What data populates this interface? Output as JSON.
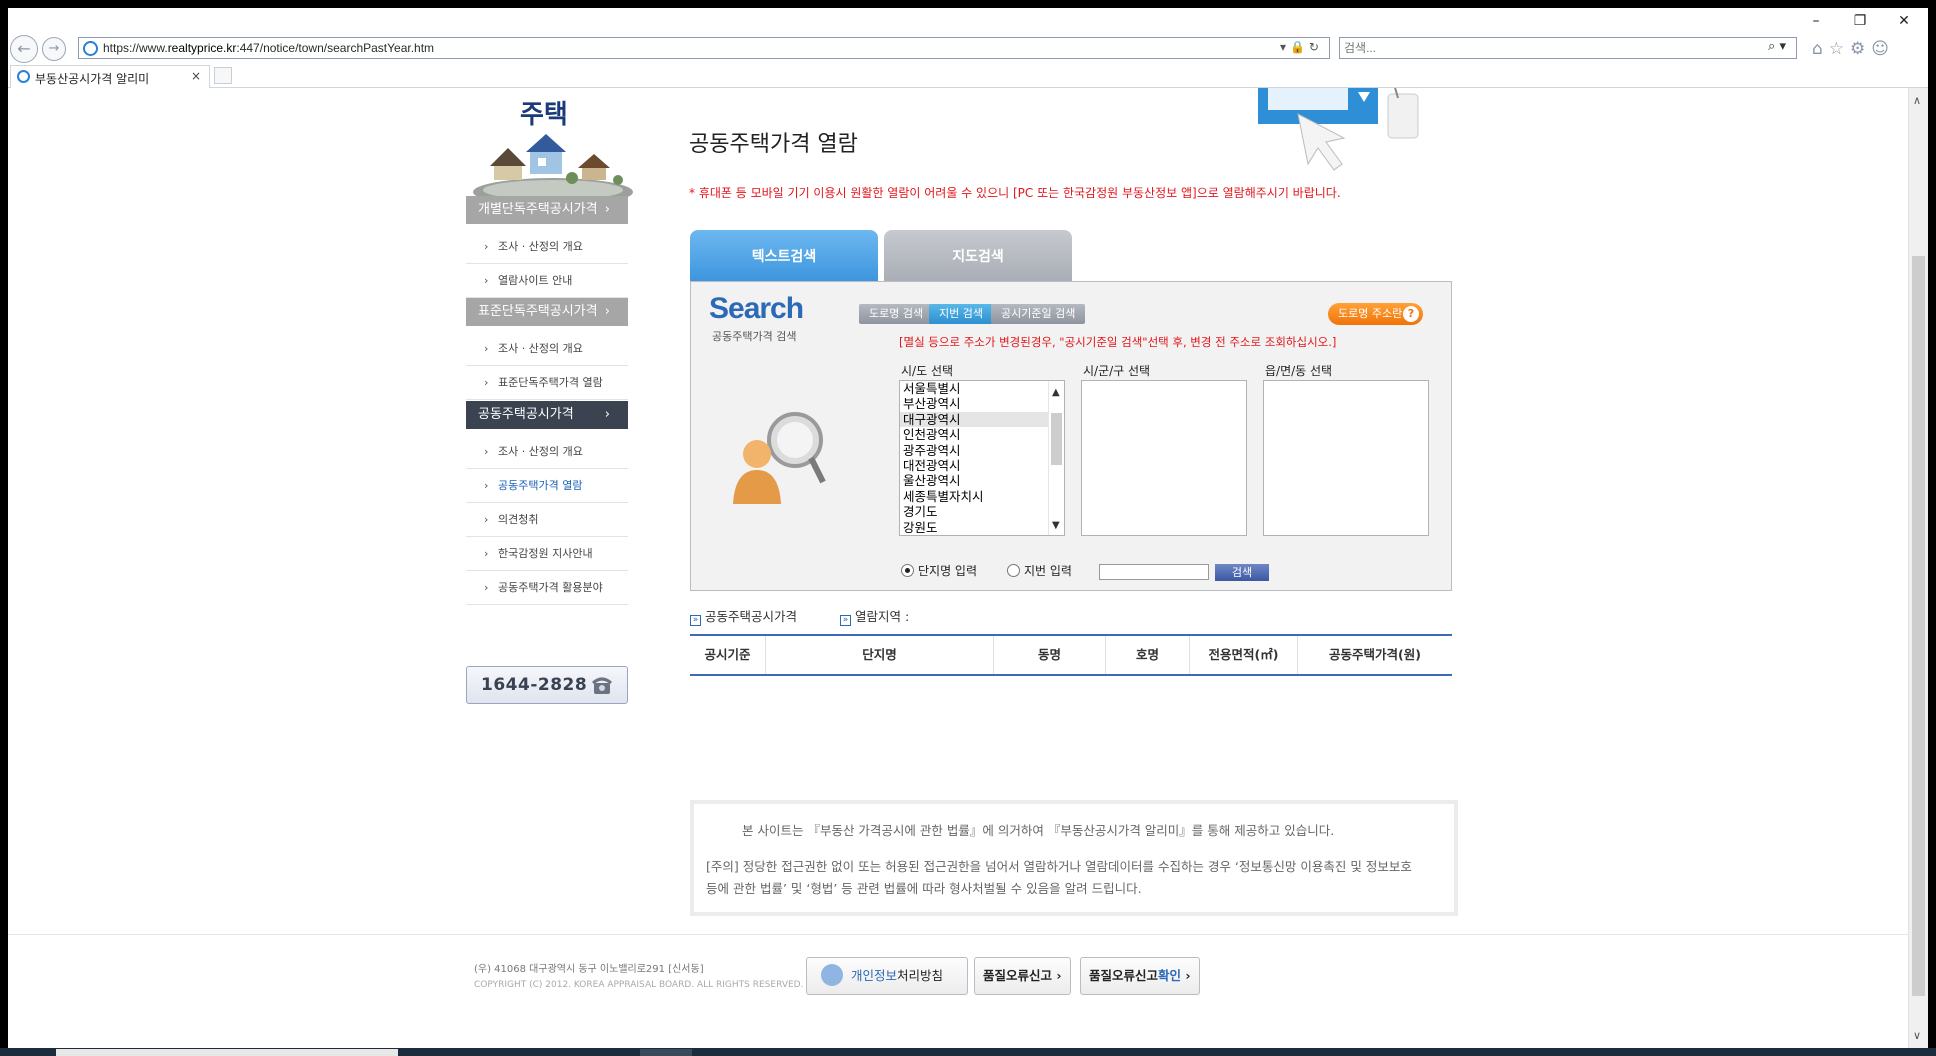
{
  "browser": {
    "url_prefix": "https://www.",
    "url_domain": "realtyprice.kr",
    "url_rest": ":447/notice/town/searchPastYear.htm",
    "search_placeholder": "검색...",
    "tab_title": "부동산공시가격 알리미",
    "tab_close": "×",
    "window_buttons": [
      "–",
      "❐",
      "✕"
    ],
    "nav_back": "←",
    "nav_forward": "→",
    "url_tools": "▾🔒↻",
    "search_icon": "⌕ ▾",
    "chrome_icons": "⌂☆⚙☺"
  },
  "sidebar": {
    "title": "주택",
    "sections": [
      {
        "label": "개별단독주택공시가격",
        "chev": "›",
        "items": [
          "조사 · 산정의 개요",
          "열람사이트 안내"
        ]
      },
      {
        "label": "표준단독주택공시가격",
        "chev": "›",
        "items": [
          "조사 · 산정의 개요",
          "표준단독주택가격 열람"
        ]
      },
      {
        "label": "공동주택공시가격",
        "chev": "›",
        "items": [
          "조사 · 산정의 개요",
          "공동주택가격 열람",
          "의견청취",
          "한국감정원 지사안내",
          "공동주택가격 활용분야"
        ]
      }
    ],
    "phone": "1644-2828"
  },
  "main": {
    "title": "공동주택가격 열람",
    "notice": "* 휴대폰 등 모바일 기기 이용시 원활한 열람이 어려울 수 있으니 [PC 또는 한국감정원 부동산정보 앱]으로 열람해주시기 바랍니다.",
    "tabs": [
      "텍스트검색",
      "지도검색"
    ]
  },
  "search_panel": {
    "logo": "Search",
    "subtitle": "공동주택가격 검색",
    "buttons": [
      "도로명 검색",
      "지번 검색",
      "공시기준일 검색"
    ],
    "road_button": "도로명 주소란",
    "road_button_help": "?",
    "warning": "[멸실 등으로 주소가 변경된경우, \"공시기준일 검색\"선택 후, 변경 전 주소로 조회하십시오.]",
    "labels": [
      "시/도 선택",
      "시/군/구 선택",
      "읍/면/동 선택"
    ],
    "sido_options": [
      "서울특별시",
      "부산광역시",
      "대구광역시",
      "인천광역시",
      "광주광역시",
      "대전광역시",
      "울산광역시",
      "세종특별자치시",
      "경기도",
      "강원도"
    ],
    "sido_selected_index": 2,
    "radio_options": [
      "단지명 입력",
      "지번 입력"
    ],
    "radio_selected_index": 0,
    "keyword_value": "",
    "search_button": "검색",
    "scroll_up": "▲",
    "scroll_down": "▼"
  },
  "results": {
    "info_label_1": "공동주택공시가격",
    "info_label_2": "열람지역 :",
    "info_icon": "»",
    "columns": [
      "공시기준",
      "단지명",
      "동명",
      "호명",
      "전용면적(㎡)",
      "공동주택가격(원)"
    ]
  },
  "disclaimer": {
    "line1": "본 사이트는 『부동산 가격공시에 관한 법률』에 의거하여 『부동산공시가격 알리미』를 통해 제공하고 있습니다.",
    "line2": "[주의] 정당한 접근권한 없이 또는 허용된 접근권한을 넘어서 열람하거나 열람데이터를 수집하는 경우 ‘정보통신망 이용촉진 및 정보보호 등에 관한 법률’ 및 ‘형법’ 등 관련 법률에 따라 형사처벌될 수 있음을 알려 드립니다."
  },
  "footer": {
    "address": "(우) 41068  대구광역시 동구 이노밸리로291 [신서동]",
    "copyright": "COPYRIGHT (C) 2012. KOREA APPRAISAL BOARD. ALL RIGHTS RESERVED.",
    "privacy_hl": "개인정보",
    "privacy_rest": "처리방침",
    "error_report": "품질오류신고",
    "error_check_a": "품질오류신고",
    "error_check_b": "확인",
    "chev": "›"
  },
  "colors": {
    "accent_blue": "#3d95de",
    "notice_red": "#e3151a",
    "orange": "#f07409",
    "sidebar_dark": "#3c4350"
  }
}
